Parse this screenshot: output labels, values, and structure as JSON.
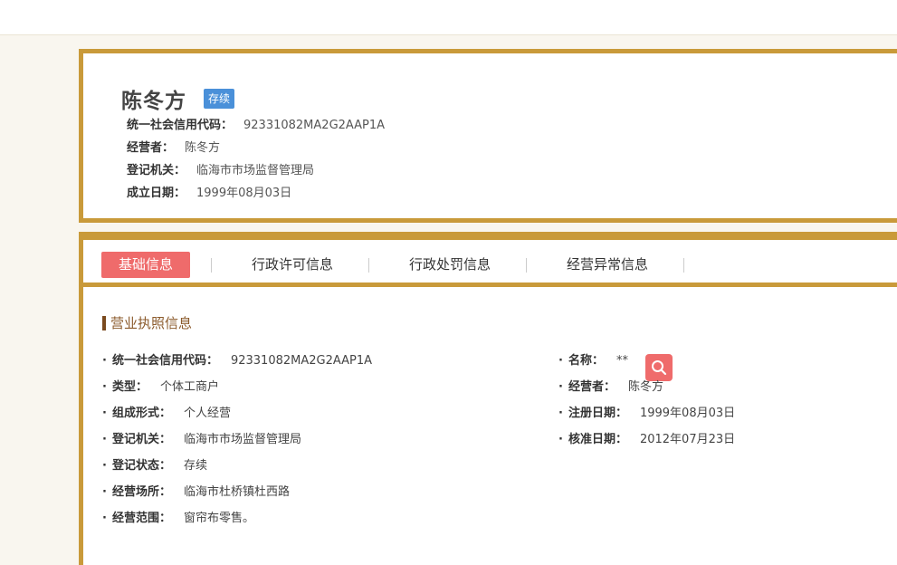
{
  "header": {
    "company_name": "陈冬方",
    "status": "存续",
    "rows": [
      {
        "label": "统一社会信用代码：",
        "value": "92331082MA2G2AAP1A"
      },
      {
        "label": "经营者：",
        "value": "陈冬方"
      },
      {
        "label": "登记机关：",
        "value": "临海市市场监督管理局"
      },
      {
        "label": "成立日期：",
        "value": "1999年08月03日"
      }
    ]
  },
  "tabs": [
    {
      "label": "基础信息",
      "active": true
    },
    {
      "label": "行政许可信息",
      "active": false
    },
    {
      "label": "行政处罚信息",
      "active": false
    },
    {
      "label": "经营异常信息",
      "active": false
    }
  ],
  "section": {
    "title": "营业执照信息",
    "bullet": "·",
    "left_fields": [
      {
        "label": "统一社会信用代码：",
        "value": "92331082MA2G2AAP1A"
      },
      {
        "label": "类型：",
        "value": "个体工商户"
      },
      {
        "label": "组成形式：",
        "value": "个人经营"
      },
      {
        "label": "登记机关：",
        "value": "临海市市场监督管理局"
      },
      {
        "label": "登记状态：",
        "value": "存续"
      },
      {
        "label": "经营场所：",
        "value": "临海市杜桥镇杜西路"
      },
      {
        "label": "经营范围：",
        "value": "窗帘布零售。"
      }
    ],
    "right_fields": [
      {
        "label": "名称：",
        "value": "**"
      },
      {
        "label": "经营者：",
        "value": "陈冬方"
      },
      {
        "label": "注册日期：",
        "value": "1999年08月03日"
      },
      {
        "label": "核准日期：",
        "value": "2012年07月23日"
      }
    ]
  },
  "icons": {
    "search": "search-icon"
  },
  "colors": {
    "accent_border": "#c99a3a",
    "active_tab": "#ef6b6b",
    "status_badge": "#4a90d9",
    "section_title": "#8b5a2b"
  }
}
